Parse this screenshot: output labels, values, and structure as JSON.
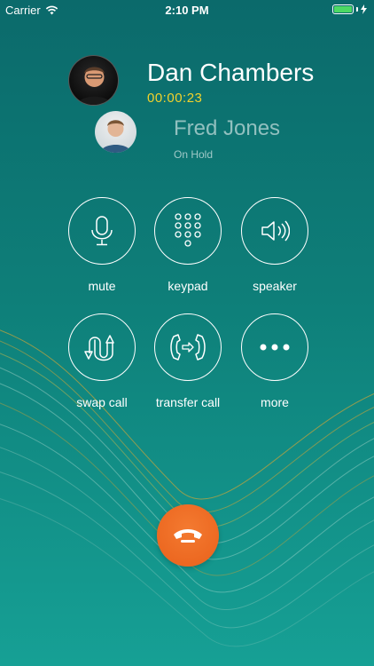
{
  "status_bar": {
    "carrier": "Carrier",
    "time": "2:10 PM"
  },
  "active_call": {
    "name": "Dan Chambers",
    "timer": "00:00:23"
  },
  "held_call": {
    "name": "Fred Jones",
    "status": "On Hold"
  },
  "controls": {
    "mute": "mute",
    "keypad": "keypad",
    "speaker": "speaker",
    "swap_call": "swap call",
    "transfer_call": "transfer call",
    "more": "more"
  },
  "colors": {
    "timer": "#f2d22c",
    "end_call": "#e9611b",
    "battery": "#4cd964"
  }
}
